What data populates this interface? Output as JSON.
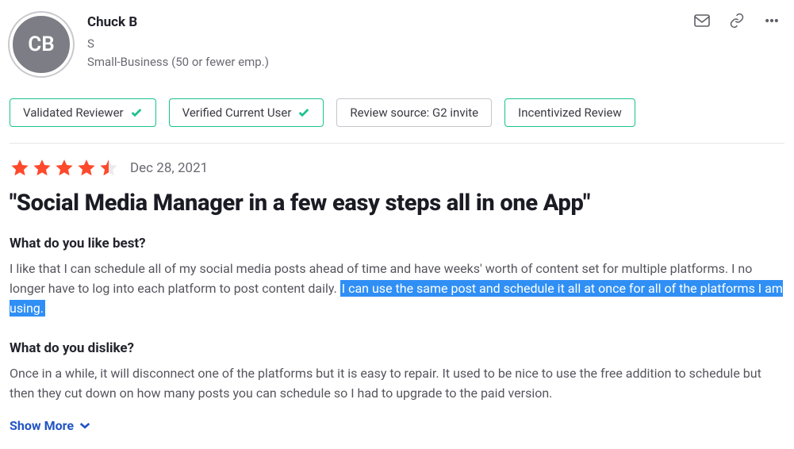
{
  "user": {
    "initials": "CB",
    "name": "Chuck B",
    "line1": "S",
    "line2": "Small-Business (50 or fewer emp.)"
  },
  "badges": {
    "validated": "Validated Reviewer",
    "verified": "Verified Current User",
    "source": "Review source: G2 invite",
    "incentivized": "Incentivized Review"
  },
  "review": {
    "date": "Dec 28, 2021",
    "title": "\"Social Media Manager in a few easy steps all in one App\"",
    "rating_full": 4,
    "rating_half": true,
    "q1": "What do you like best?",
    "a1_pre": "I like that I can schedule all of my social media posts ahead of time and have weeks' worth of content set for multiple platforms. I no longer have to log into each platform to post content daily. ",
    "a1_hl": "I can use the same post and schedule it all at once for all of the platforms I am using.",
    "q2": "What do you dislike?",
    "a2": "Once in a while, it will disconnect one of the platforms but it is easy to repair. It used to be nice to use the free addition to schedule but then they cut down on how many posts you can schedule so I had to upgrade to the paid version.",
    "show_more": "Show More"
  }
}
